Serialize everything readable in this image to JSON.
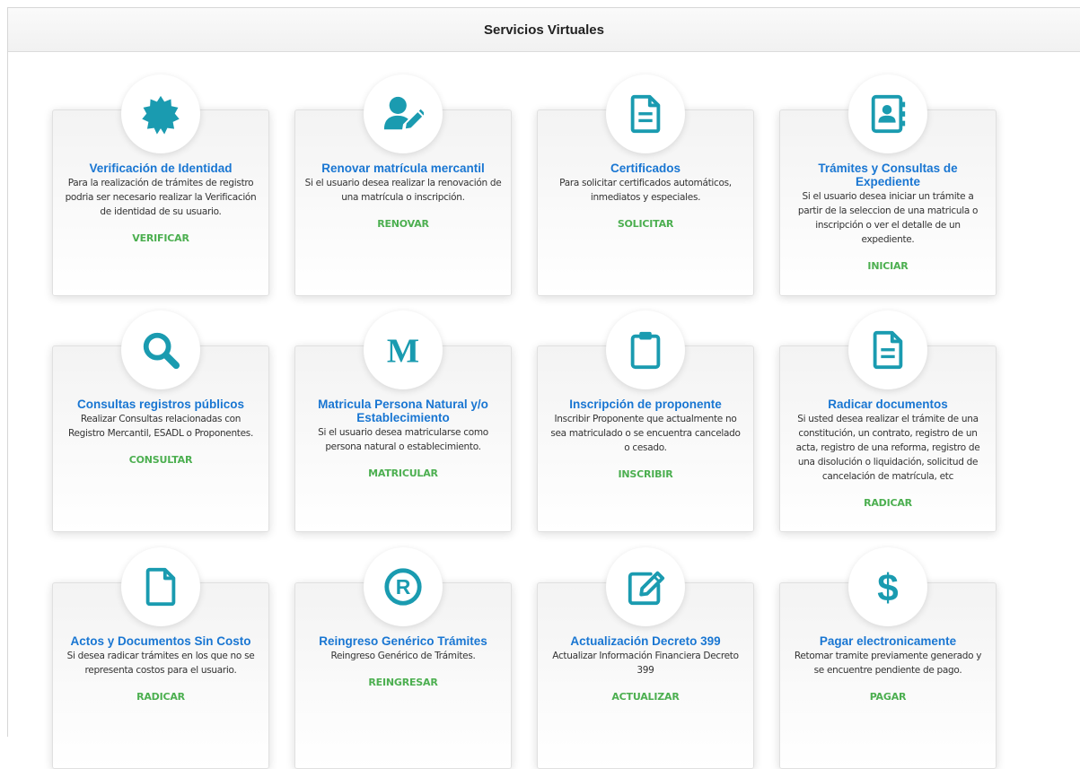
{
  "panel": {
    "title": "Servicios Virtuales"
  },
  "colors": {
    "icon": "#1a9bb0",
    "title": "#1976d2",
    "action": "#4caf50"
  },
  "cards": [
    {
      "icon": "badge-check-icon",
      "title": "Verificación de Identidad",
      "description": "Para la realización de trámites de registro podria ser necesario realizar la Verificación de identidad de su usuario.",
      "action": "VERIFICAR"
    },
    {
      "icon": "user-edit-icon",
      "title": "Renovar matrícula mercantil",
      "description": "Si el usuario desea realizar la renovación de una matrícula o inscripción.",
      "action": "RENOVAR"
    },
    {
      "icon": "file-text-icon",
      "title": "Certificados",
      "description": "Para solicitar certificados automáticos, inmediatos y especiales.",
      "action": "SOLICITAR"
    },
    {
      "icon": "address-book-icon",
      "title": "Trámites y Consultas de Expediente",
      "description": "Si el usuario desea iniciar un trámite a partir de la seleccion de una matricula o inscripción o ver el detalle de un expediente.",
      "action": "INICIAR"
    },
    {
      "icon": "search-icon",
      "title": "Consultas registros públicos",
      "description": "Realizar Consultas relacionadas con Registro Mercantil, ESADL o Proponentes.",
      "action": "CONSULTAR"
    },
    {
      "icon": "letter-m-icon",
      "icon_text": "M",
      "title": "Matricula Persona Natural y/o Establecimiento",
      "description": "Si el usuario desea matricularse como persona natural o establecimiento.",
      "action": "MATRICULAR"
    },
    {
      "icon": "clipboard-icon",
      "title": "Inscripción de proponente",
      "description": "Inscribir Proponente que actualmente no sea matriculado o se encuentra cancelado o cesado.",
      "action": "INSCRIBIR"
    },
    {
      "icon": "file-text-icon",
      "title": "Radicar documentos",
      "description": "Si usted desea realizar el trámite de una constitución, un contrato, registro de un acta, registro de una reforma, registro de una disolución o liquidación, solicitud de cancelación de matrícula, etc",
      "action": "RADICAR"
    },
    {
      "icon": "file-icon",
      "title": "Actos y Documentos Sin Costo",
      "description": "Si desea radicar trámites en los que no se representa costos para el usuario.",
      "action": "RADICAR"
    },
    {
      "icon": "registered-icon",
      "icon_text": "R",
      "title": "Reingreso Genérico Trámites",
      "description": "Reingreso Genérico de Trámites.",
      "action": "REINGRESAR"
    },
    {
      "icon": "edit-icon",
      "title": "Actualización Decreto 399",
      "description": "Actualizar Información Financiera Decreto 399",
      "action": "ACTUALIZAR"
    },
    {
      "icon": "dollar-icon",
      "icon_text": "$",
      "title": "Pagar electronicamente",
      "description": "Retomar tramite previamente generado y se encuentre pendiente de pago.",
      "action": "PAGAR"
    }
  ]
}
